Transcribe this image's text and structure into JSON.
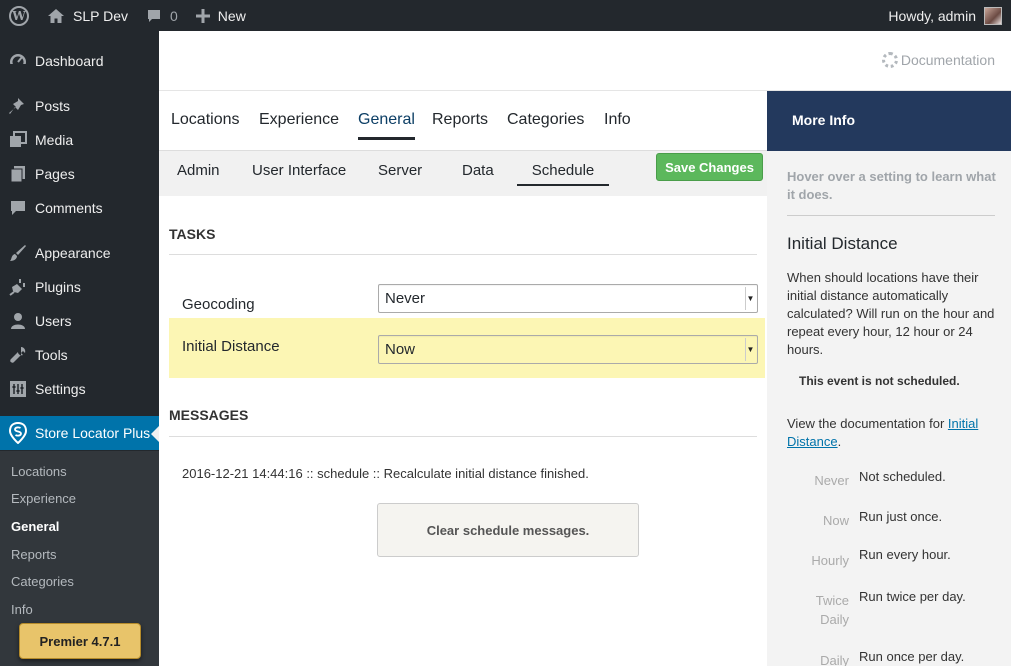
{
  "admin_bar": {
    "site_name": "SLP Dev",
    "comments_count": "0",
    "new_label": "New",
    "greeting": "Howdy, admin"
  },
  "sidebar": {
    "items": [
      {
        "label": "Dashboard",
        "icon": "dashboard-icon"
      },
      {
        "label": "Posts",
        "icon": "pushpin-icon"
      },
      {
        "label": "Media",
        "icon": "media-icon"
      },
      {
        "label": "Pages",
        "icon": "pages-icon"
      },
      {
        "label": "Comments",
        "icon": "comment-icon"
      },
      {
        "label": "Appearance",
        "icon": "brush-icon"
      },
      {
        "label": "Plugins",
        "icon": "plugin-icon"
      },
      {
        "label": "Users",
        "icon": "user-icon"
      },
      {
        "label": "Tools",
        "icon": "wrench-icon"
      },
      {
        "label": "Settings",
        "icon": "settings-icon"
      },
      {
        "label": "Store Locator Plus",
        "icon": "store-locator-icon"
      }
    ],
    "submenu": [
      "Locations",
      "Experience",
      "General",
      "Reports",
      "Categories",
      "Info"
    ],
    "badge": "Premier 4.7.1"
  },
  "header": {
    "documentation_label": "Documentation"
  },
  "nav_tabs": [
    "Locations",
    "Experience",
    "General",
    "Reports",
    "Categories",
    "Info"
  ],
  "sub_tabs": [
    "Admin",
    "User Interface",
    "Server",
    "Data",
    "Schedule"
  ],
  "save_button": "Save Changes",
  "tasks": {
    "title": "TASKS",
    "rows": [
      {
        "label": "Geocoding",
        "value": "Never"
      },
      {
        "label": "Initial Distance",
        "value": "Now"
      }
    ]
  },
  "messages": {
    "title": "MESSAGES",
    "line": "2016-12-21 14:44:16 :: schedule :: Recalculate initial distance finished.",
    "clear_button": "Clear schedule messages."
  },
  "info_panel": {
    "heading": "More Info",
    "hint": "Hover over a setting to learn what it does.",
    "title": "Initial Distance",
    "description": "When should locations have their initial distance automatically calculated? Will run on the hour and repeat every hour, 12 hour or 24 hours.",
    "status": "This event is not scheduled.",
    "doc_prefix": "View the documentation for ",
    "doc_link": "Initial Distance",
    "doc_suffix": ".",
    "options": [
      {
        "key": "Never",
        "desc": "Not scheduled."
      },
      {
        "key": "Now",
        "desc": "Run just once."
      },
      {
        "key": "Hourly",
        "desc": "Run every hour."
      },
      {
        "key": "Twice Daily",
        "desc": "Run twice per day."
      },
      {
        "key": "Daily",
        "desc": "Run once per day."
      }
    ]
  },
  "colors": {
    "admin_bar_bg": "#23282d",
    "menu_current": "#0073aa",
    "info_header_bg": "#23395d",
    "save_green": "#5cb85c",
    "highlight_row": "#fcf6b4"
  }
}
